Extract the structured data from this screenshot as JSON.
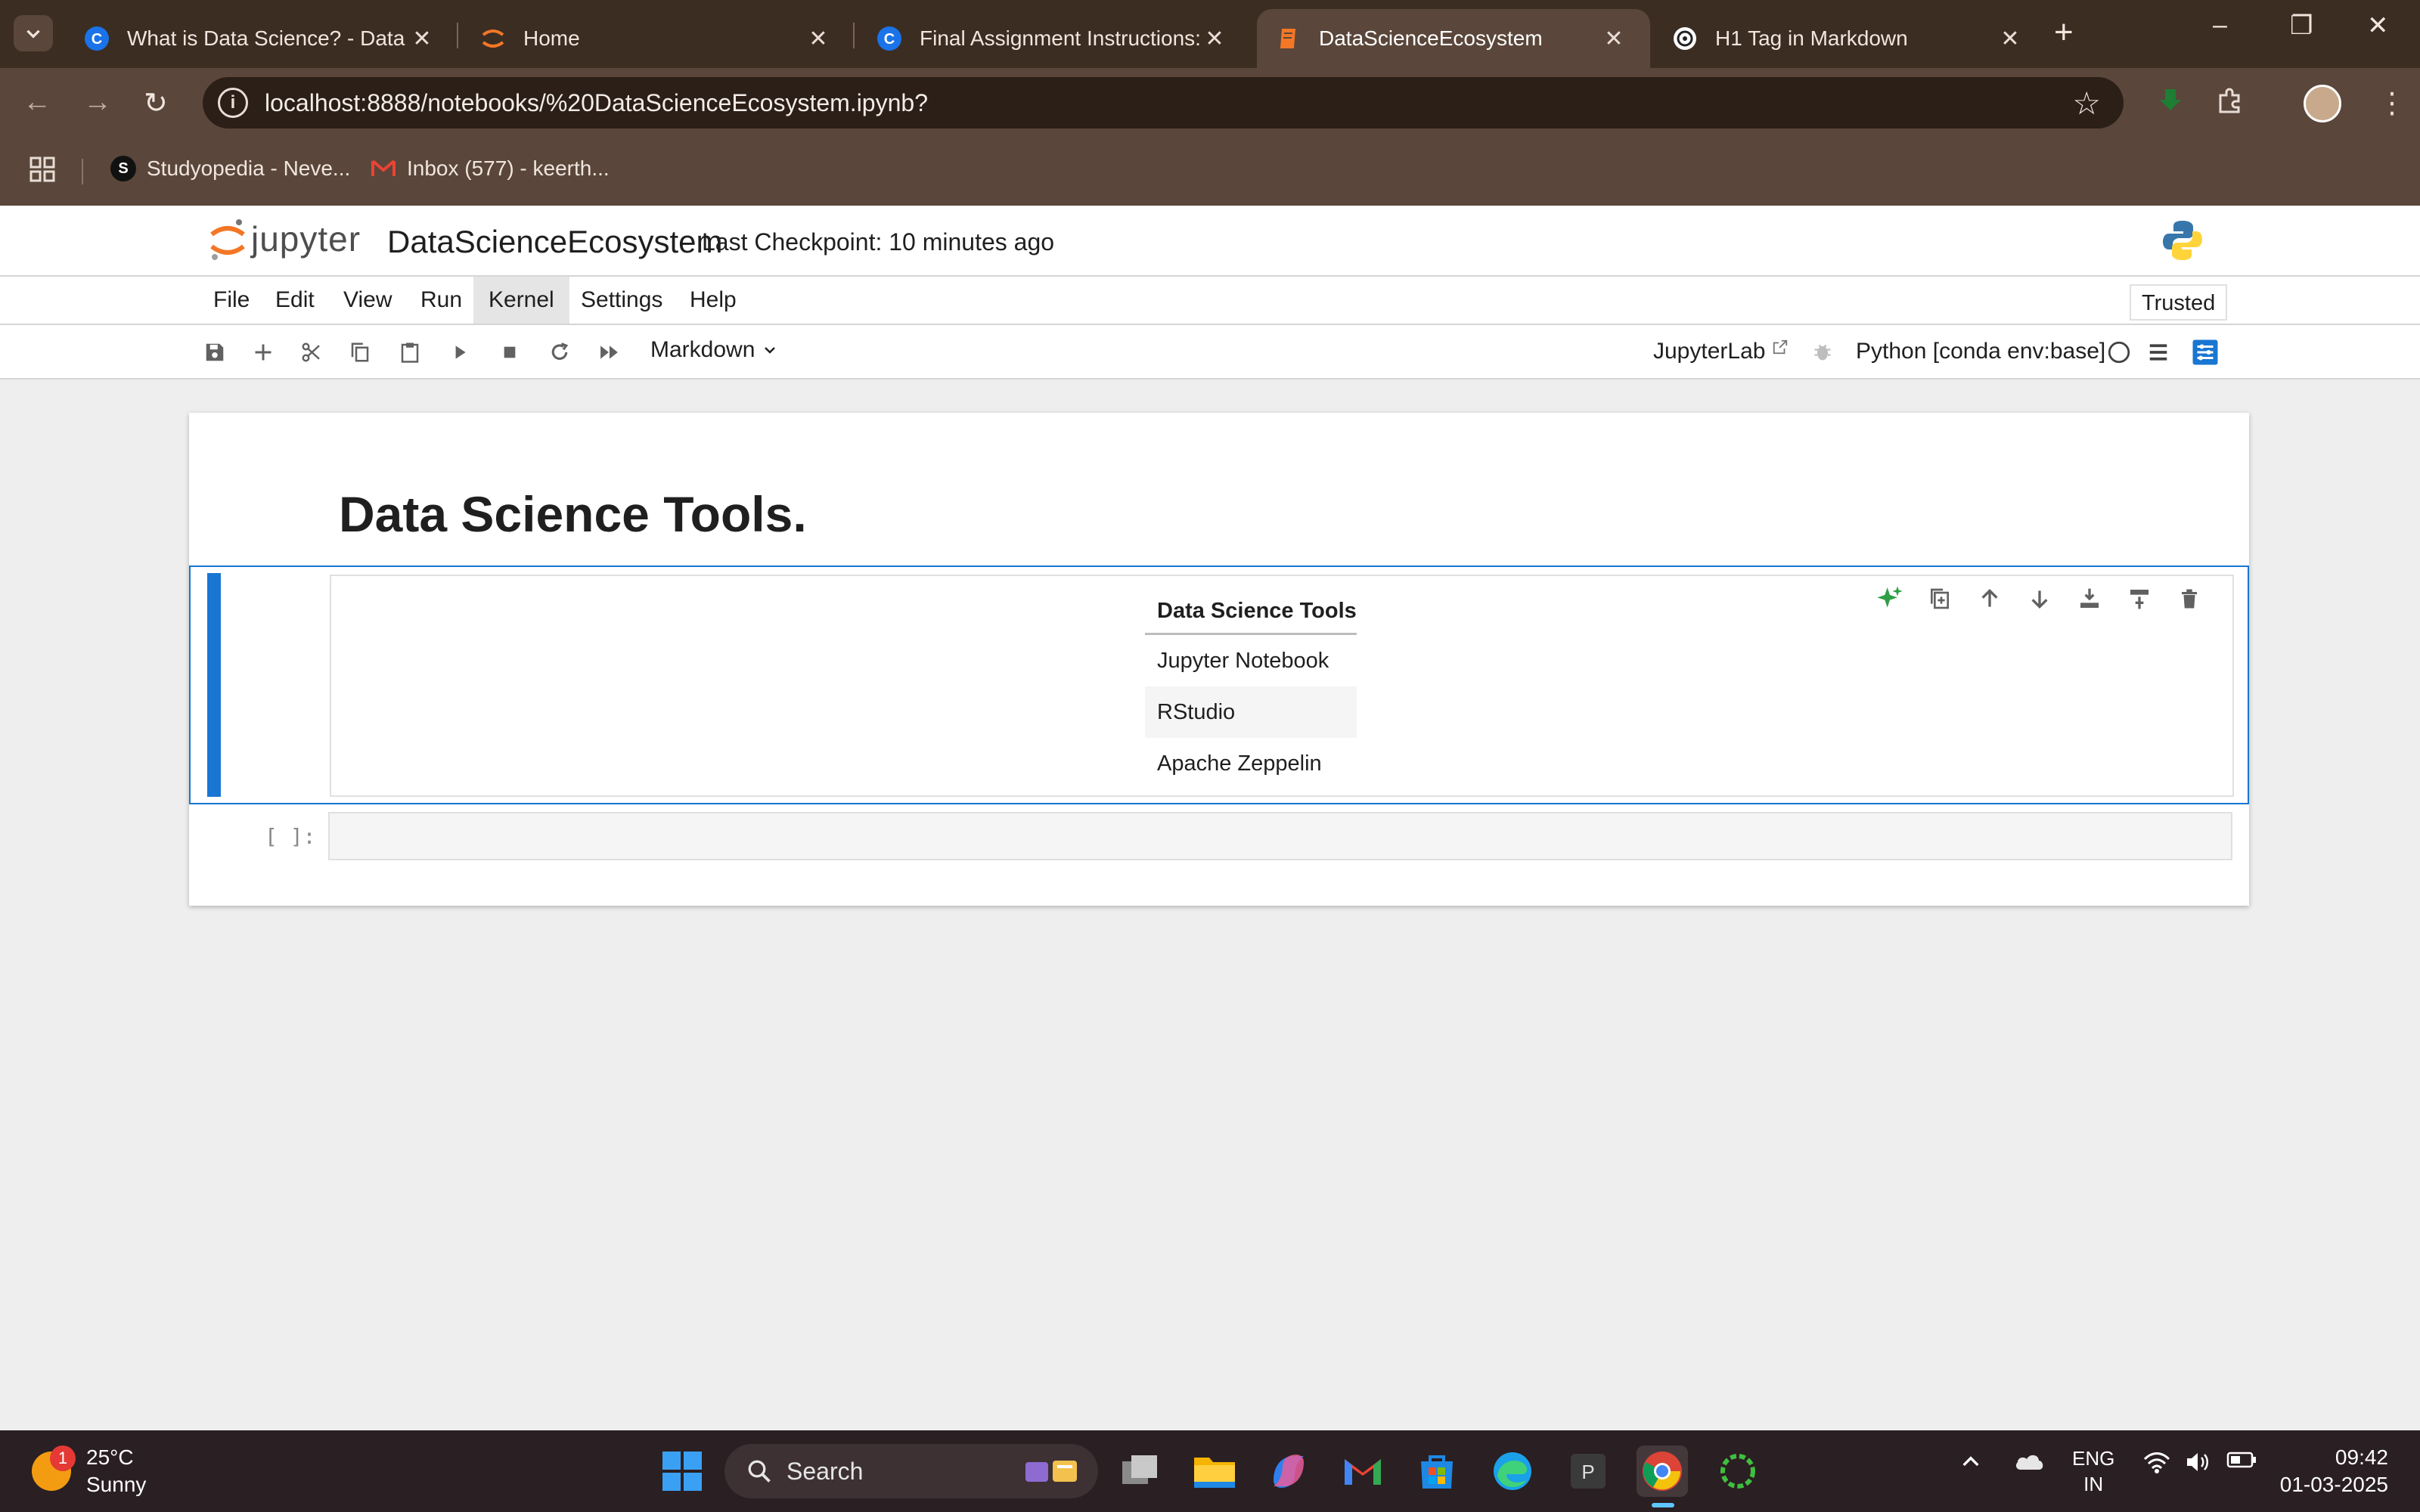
{
  "browser": {
    "tabs": [
      {
        "title": "What is Data Science? - Data li",
        "icon": "c-logo-icon",
        "active": false
      },
      {
        "title": "Home",
        "icon": "jupyter-favicon-icon",
        "active": false
      },
      {
        "title": "Final Assignment Instructions: (",
        "icon": "c-logo-icon",
        "active": false
      },
      {
        "title": "DataScienceEcosystem",
        "icon": "notebook-favicon-icon",
        "active": true
      },
      {
        "title": "H1 Tag in Markdown",
        "icon": "chatgpt-icon",
        "active": false
      }
    ],
    "url": "localhost:8888/notebooks/%20DataScienceEcosystem.ipynb?",
    "bookmarks": [
      {
        "label": "Studyopedia - Neve...",
        "icon": "studyopedia-icon"
      },
      {
        "label": "Inbox (577) - keerth...",
        "icon": "gmail-icon"
      }
    ]
  },
  "jupyter": {
    "logo_text": "jupyter",
    "notebook_name": "DataScienceEcosystem",
    "checkpoint": "Last Checkpoint: 10 minutes ago",
    "menu": [
      "File",
      "Edit",
      "View",
      "Run",
      "Kernel",
      "Settings",
      "Help"
    ],
    "trusted": "Trusted",
    "cell_type": "Markdown",
    "jupyterlab_link": "JupyterLab",
    "kernel_name": "Python [conda env:base]"
  },
  "notebook": {
    "heading": "Data Science Tools.",
    "table": {
      "header": "Data Science Tools",
      "rows": [
        "Jupyter Notebook",
        "RStudio",
        "Apache Zeppelin"
      ]
    },
    "empty_prompt": "[ ]:"
  },
  "taskbar": {
    "weather_temp": "25°C",
    "weather_desc": "Sunny",
    "weather_badge": "1",
    "search_label": "Search",
    "lang_line1": "ENG",
    "lang_line2": "IN",
    "time": "09:42",
    "date": "01-03-2025"
  },
  "colors": {
    "browser_frame": "#3c2d22",
    "browser_toolbar": "#5a463a",
    "jupyter_accent": "#1976d2",
    "jupyter_orange": "#f37726"
  }
}
